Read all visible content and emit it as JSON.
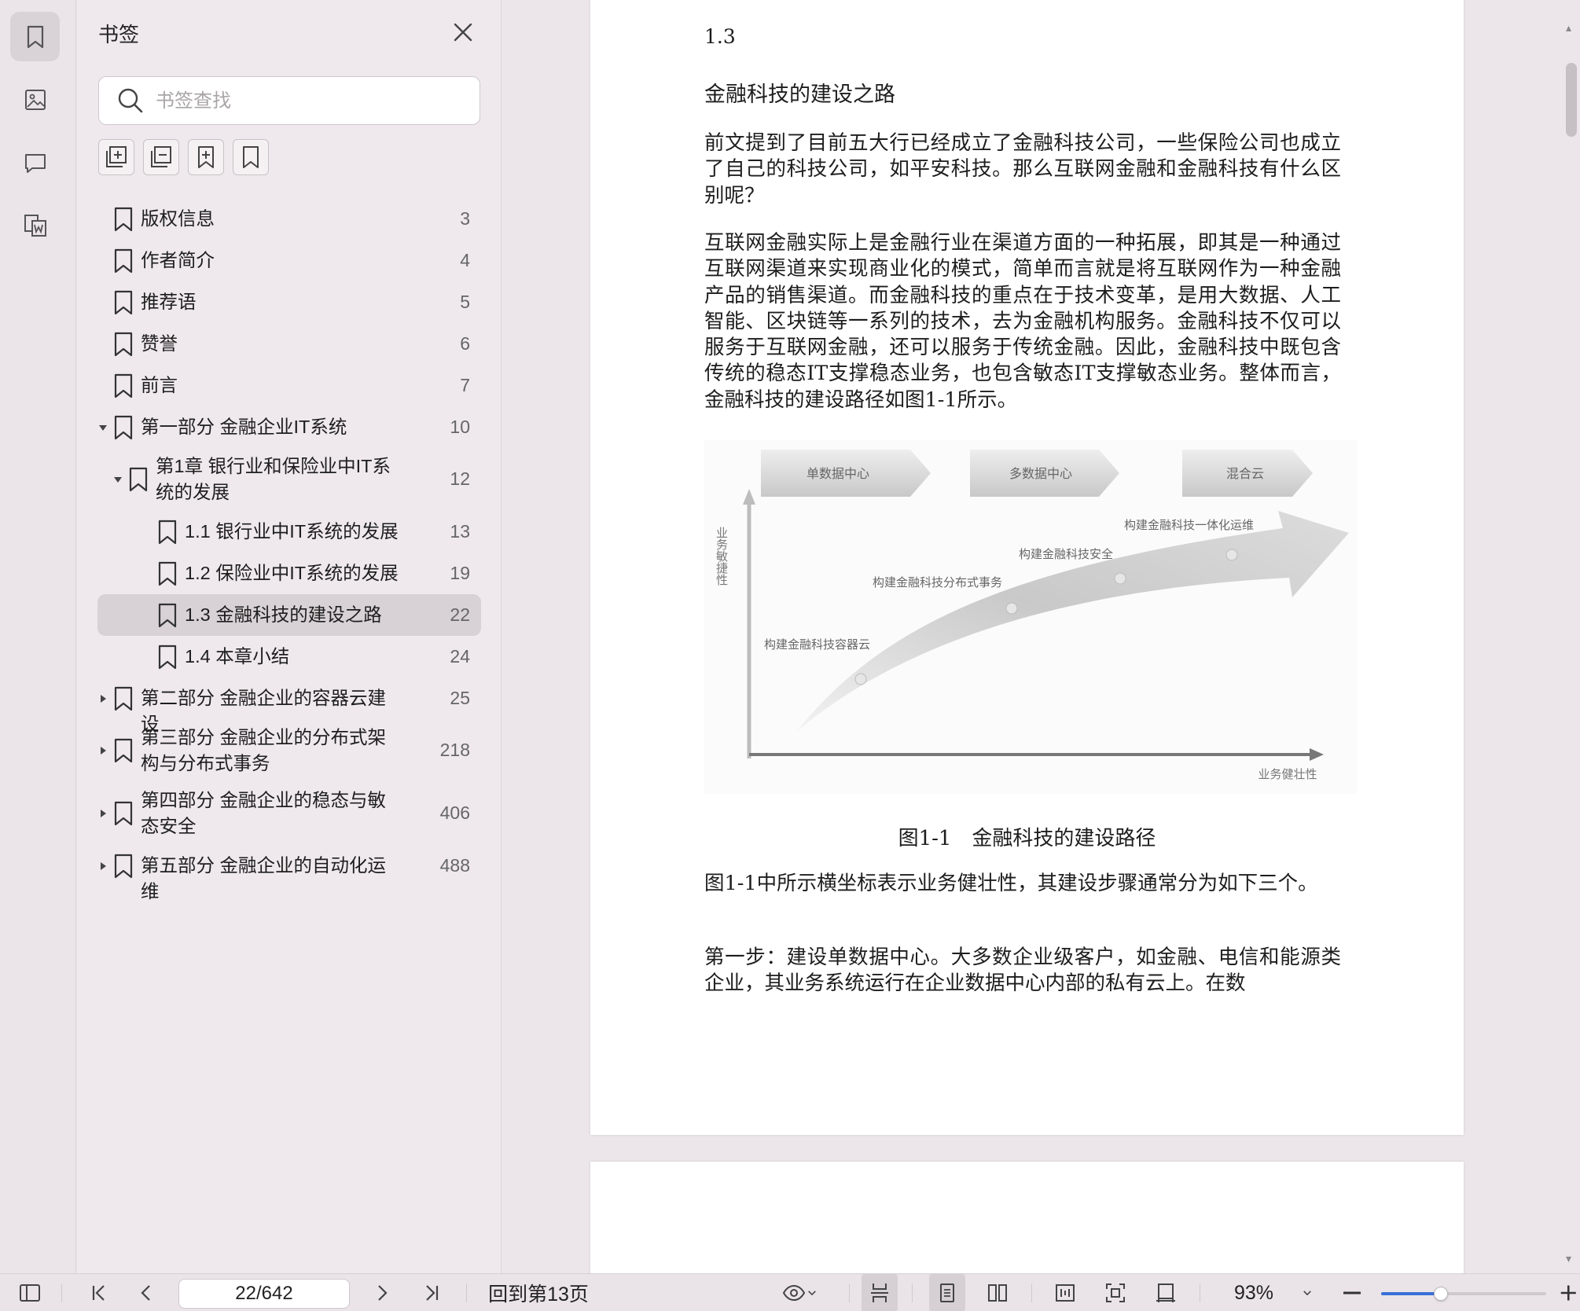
{
  "sidebar": {
    "title": "书签",
    "search_placeholder": "书签查找",
    "rail_icons": [
      "bookmark-icon",
      "image-icon",
      "comment-icon",
      "word-convert-icon"
    ],
    "tool_icons": [
      "expand-all-icon",
      "collapse-all-icon",
      "add-bookmark-icon",
      "bookmark-outline-icon"
    ],
    "items": [
      {
        "label": "版权信息",
        "page": "3"
      },
      {
        "label": "作者简介",
        "page": "4"
      },
      {
        "label": "推荐语",
        "page": "5"
      },
      {
        "label": "赞誉",
        "page": "6"
      },
      {
        "label": "前言",
        "page": "7"
      },
      {
        "label": "第一部分 金融企业IT系统",
        "page": "10",
        "caret": "down"
      },
      {
        "label": "第1章 银行业和保险业中IT系统的发展",
        "page": "12",
        "caret": "down"
      },
      {
        "label": "1.1 银行业中IT系统的发展",
        "page": "13"
      },
      {
        "label": "1.2 保险业中IT系统的发展",
        "page": "19"
      },
      {
        "label": "1.3 金融科技的建设之路",
        "page": "22",
        "active": true
      },
      {
        "label": "1.4 本章小结",
        "page": "24"
      },
      {
        "label": "第二部分 金融企业的容器云建设",
        "page": "25",
        "caret": "right"
      },
      {
        "label": "第三部分 金融企业的分布式架构与分布式事务",
        "page": "218",
        "caret": "right"
      },
      {
        "label": "第四部分 金融企业的稳态与敏态安全",
        "page": "406",
        "caret": "right"
      },
      {
        "label": "第五部分 金融企业的自动化运维",
        "page": "488",
        "caret": "right"
      }
    ]
  },
  "document": {
    "section_number": "1.3",
    "section_title": "金融科技的建设之路",
    "paragraphs": [
      "前文提到了目前五大行已经成立了金融科技公司，一些保险公司也成立了自己的科技公司，如平安科技。那么互联网金融和金融科技有什么区别呢？",
      "互联网金融实际上是金融行业在渠道方面的一种拓展，即其是一种通过互联网渠道来实现商业化的模式，简单而言就是将互联网作为一种金融产品的销售渠道。而金融科技的重点在于技术变革，是用大数据、人工智能、区块链等一系列的技术，去为金融机构服务。金融科技不仅可以服务于互联网金融，还可以服务于传统金融。因此，金融科技中既包含传统的稳态IT支撑稳态业务，也包含敏态IT支撑敏态业务。整体而言，金融科技的建设路径如图1-1所示。",
      "图1-1中所示横坐标表示业务健壮性，其建设步骤通常分为如下三个。",
      "第一步：建设单数据中心。大多数企业级客户，如金融、电信和能源类企业，其业务系统运行在企业数据中心内部的私有云上。在数"
    ],
    "figure": {
      "stages": [
        "单数据中心",
        "多数据中心",
        "混合云"
      ],
      "y_axis_label": "业务敏捷性",
      "x_axis_label": "业务健壮性",
      "milestones": [
        "构建金融科技容器云",
        "构建金融科技分布式事务",
        "构建金融科技安全",
        "构建金融科技一体化运维"
      ],
      "caption": "图1-1　金融科技的建设路径"
    }
  },
  "toolbar": {
    "page_indicator": "22/642",
    "back_to_page": "回到第13页",
    "zoom": "93%",
    "zoom_level": 0.36,
    "accent": "#3a6fd8"
  }
}
